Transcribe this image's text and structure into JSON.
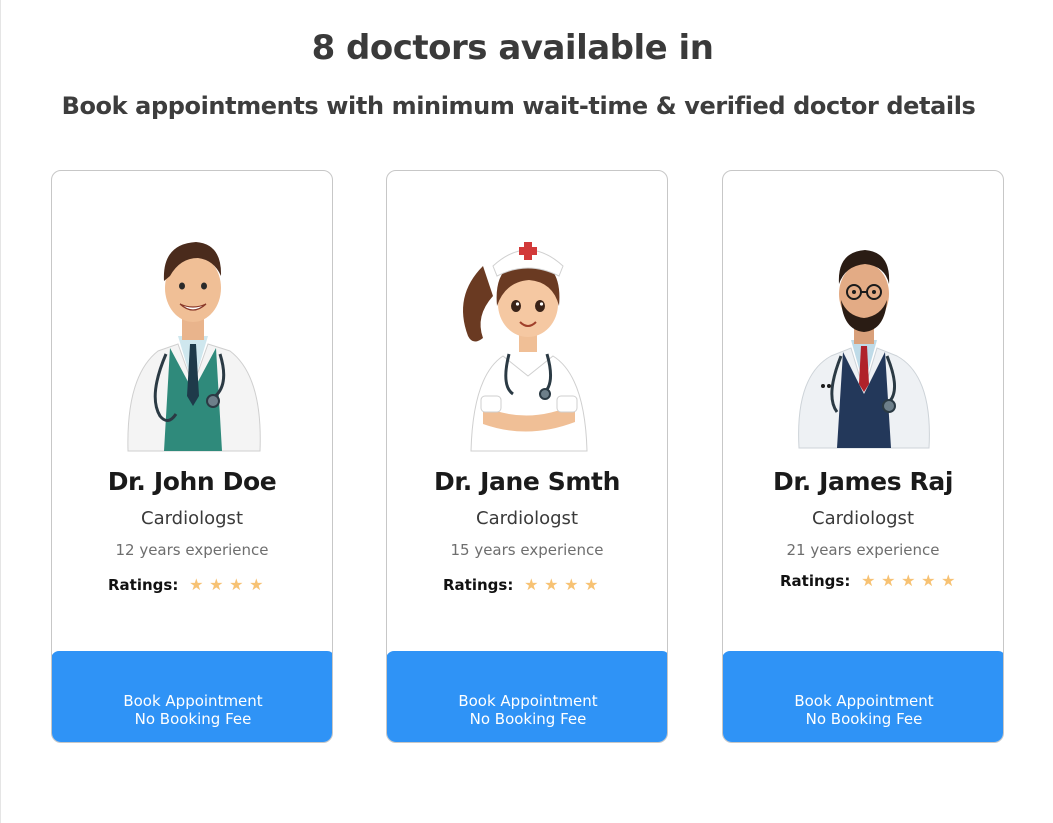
{
  "header": {
    "title": "8 doctors available in",
    "subtitle": "Book appointments with minimum wait-time & verified doctor details"
  },
  "doctors": [
    {
      "name": "Dr. John Doe",
      "specialty": "Cardiologst",
      "experience": "12 years experience",
      "ratings_label": "Ratings:",
      "stars": 4,
      "button_line1": "Book Appointment",
      "button_line2": "No Booking Fee",
      "avatar_icon": "male-doctor-avatar"
    },
    {
      "name": "Dr. Jane Smth",
      "specialty": "Cardiologst",
      "experience": "15 years experience",
      "ratings_label": "Ratings:",
      "stars": 4,
      "button_line1": "Book Appointment",
      "button_line2": "No Booking Fee",
      "avatar_icon": "female-nurse-avatar"
    },
    {
      "name": "Dr. James Raj",
      "specialty": "Cardiologst",
      "experience": "21 years experience",
      "ratings_label": "Ratings:",
      "stars": 5,
      "button_line1": "Book Appointment",
      "button_line2": "No Booking Fee",
      "avatar_icon": "bearded-doctor-avatar"
    }
  ],
  "colors": {
    "accent": "#2f93f6",
    "star": "#f7c273"
  }
}
